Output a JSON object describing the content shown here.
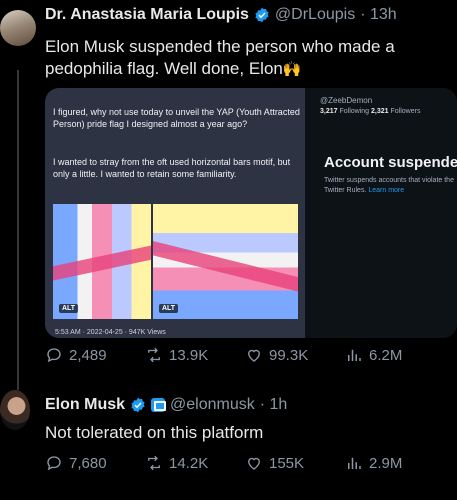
{
  "tweet1": {
    "name": "Dr. Anastasia Maria Loupis",
    "handle": "@DrLoupis",
    "time": "· 13h",
    "text": "Elon Musk suspended the person who made a pedophilia flag. Well done, Elon",
    "emoji": "🙌",
    "media": {
      "paragraph1": "I figured, why not use today to unveil the YAP (Youth Attracted Person) pride flag I designed almost a year ago?",
      "paragraph2": "I wanted to stray from the oft used horizontal bars motif, but only a little. I wanted to retain some familiarity.",
      "alt_label": "ALT",
      "timestamp": "5:53 AM · 2022-04-25 · 947K Views",
      "profile_handle": "@ZeebDemon",
      "following_count": "3,217",
      "following_label": "Following",
      "followers_count": "2,321",
      "followers_label": "Followers",
      "suspended_title": "Account suspended",
      "suspended_text": "Twitter suspends accounts that violate the Twitter Rules.",
      "learn_more": "Learn more"
    },
    "stats": {
      "replies": "2,489",
      "retweets": "13.9K",
      "likes": "99.3K",
      "views": "6.2M"
    }
  },
  "tweet2": {
    "name": "Elon Musk",
    "handle": "@elonmusk",
    "time": "· 1h",
    "text": "Not tolerated on this platform",
    "stats": {
      "replies": "7,680",
      "retweets": "14.2K",
      "likes": "155K",
      "views": "2.9M"
    }
  },
  "colors": {
    "background": "#000000",
    "verified": "#1d9bf0",
    "muted": "#8b98a5"
  },
  "icons": [
    "verified-icon",
    "reply-icon",
    "retweet-icon",
    "like-icon",
    "views-icon"
  ]
}
